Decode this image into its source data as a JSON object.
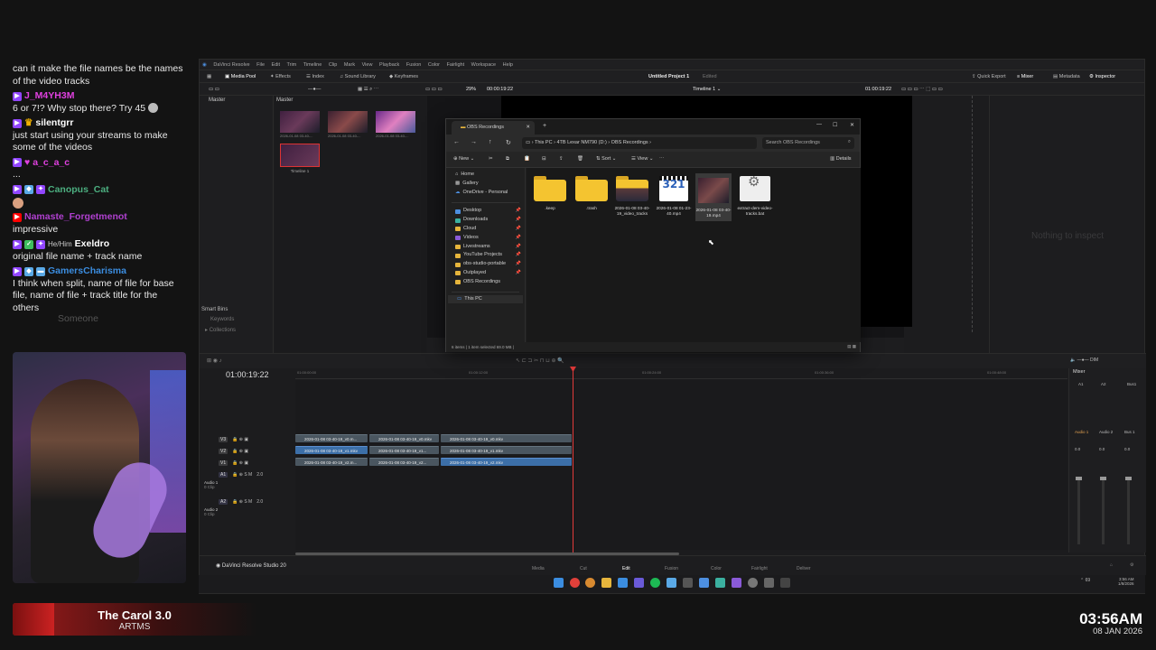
{
  "chat": {
    "messages": [
      {
        "text": "can it make the file names be the names of the video tracks"
      },
      {
        "user": "J_M4YH3M",
        "color": "#e040e0",
        "text": "6 or 7!? Why stop there? Try 45"
      },
      {
        "user": "silentgrr",
        "color": "#ffffff",
        "text": "just start using your streams to make some of the videos"
      },
      {
        "user": "a_c_a_c",
        "color": "#e040e0",
        "text": "..."
      },
      {
        "user": "Canopus_Cat",
        "color": "#4caf80",
        "text": ""
      },
      {
        "user": "Namaste_Forgetmenot",
        "color": "#b040d0",
        "text": "impressive"
      },
      {
        "user": "Exeldro",
        "pronoun": "He/Him",
        "color": "#ffffff",
        "text": "original file name + track name"
      },
      {
        "user": "GamersCharisma",
        "color": "#3b8de0",
        "text": "I think when split, name of file for base file, name of file + track title for the others"
      }
    ],
    "faded_user": "Someone"
  },
  "now_playing": {
    "title": "The Carol 3.0",
    "artist": "ARTMS"
  },
  "clock": {
    "time": "03:56AM",
    "date": "08 JAN 2026"
  },
  "resolve": {
    "menu": [
      "DaVinci Resolve",
      "File",
      "Edit",
      "Trim",
      "Timeline",
      "Clip",
      "Mark",
      "View",
      "Playback",
      "Fusion",
      "Color",
      "Fairlight",
      "Workspace",
      "Help"
    ],
    "toolbar_left": [
      "Media Pool",
      "Effects",
      "Index",
      "Sound Library",
      "Keyframes"
    ],
    "project_title": "Untitled Project 1",
    "project_status": "Edited",
    "toolbar_right": [
      "Quick Export",
      "Mixer",
      "Metadata",
      "Inspector"
    ],
    "zoom": "29%",
    "source_tc": "00:00:19:22",
    "timeline_name": "Timeline 1",
    "record_tc": "01:00:19:22",
    "bin_master": "Master",
    "pool_header": "Master",
    "pool_clips": [
      "2026-01-08 03-40-...",
      "2026-01-08 03-40-...",
      "2026-01-08 03-40-..."
    ],
    "pool_timeline": "Timeline 1",
    "smart_bins": "Smart Bins",
    "smart_items": [
      "Keywords",
      "Collections"
    ],
    "inspector_empty": "Nothing to inspect",
    "timeline_tc": "01:00:19:22",
    "ruler": [
      "01:00:00:00",
      "01:00:12:00",
      "01:00:24:00",
      "01:00:36:00",
      "01:00:48:00"
    ],
    "tracks": [
      {
        "id": "V3",
        "clips": [
          "2026-01-08 03-40-19_v0.m...",
          "2026-01-08 03-40-19_v0.mkv",
          "2026-01-08 03-40-19_v0.mkv"
        ]
      },
      {
        "id": "V2",
        "clips": [
          "2026-01-08 03-40-19_v1.mkv",
          "2026-01-08 03-40-19_v1...",
          "2026-01-08 03-40-19_v1.mkv"
        ]
      },
      {
        "id": "V1",
        "clips": [
          "2026-01-08 03-40-19_v2.m...",
          "2026-01-08 03-40-19_v2...",
          "2026-01-08 03-40-19_v2.mkv"
        ]
      }
    ],
    "audio_tracks": [
      {
        "id": "A1",
        "name": "Audio 1",
        "sub": "0 Clip",
        "level": "2.0"
      },
      {
        "id": "A2",
        "name": "Audio 2",
        "sub": "0 Clip",
        "level": "2.0"
      }
    ],
    "mixer": {
      "title": "Mixer",
      "channels": [
        "A1",
        "A2",
        "Bus1"
      ],
      "channels_lower": [
        "Audio 1",
        "Audio 2",
        "Bus 1"
      ],
      "dim": "DIM",
      "fader_values": [
        "0.0",
        "0.0",
        "0.0"
      ]
    },
    "pages": [
      "Media",
      "Cut",
      "Edit",
      "Fusion",
      "Color",
      "Fairlight",
      "Deliver"
    ],
    "active_page": "Edit",
    "brand": "DaVinci Resolve Studio 20"
  },
  "explorer": {
    "tab_title": "OBS Recordings",
    "breadcrumb": [
      "This PC",
      "4TB Lexar NM790 (D:)",
      "OBS Recordings"
    ],
    "search_placeholder": "Search OBS Recordings",
    "commands": [
      "New",
      "Sort",
      "View",
      "Details"
    ],
    "nav_top": [
      "Home",
      "Gallery",
      "OneDrive - Personal"
    ],
    "nav_pinned": [
      "Desktop",
      "Downloads",
      "Cloud",
      "Videos",
      "Livestreams",
      "YouTube Projects",
      "obs-studio-portable",
      "Outplayed",
      "OBS Recordings"
    ],
    "nav_bottom": [
      "This PC"
    ],
    "files": [
      {
        "name": ".keep",
        "type": "folder"
      },
      {
        "name": ".trash",
        "type": "folder"
      },
      {
        "name": "2026-01-08 03-40-19_video_tracks",
        "type": "folder-media"
      },
      {
        "name": "2026-01-08 01-23-40.mp4",
        "type": "video-321"
      },
      {
        "name": "2026-01-08 03-40-19.mp4",
        "type": "video-thumb"
      },
      {
        "name": "extract-dem-video-tracks.bat",
        "type": "bat"
      }
    ],
    "status": [
      "6 items",
      "1 item selected",
      "69.0 MB"
    ]
  },
  "taskbar": {
    "tray_temp": "69",
    "tray_time": "3:56 AM",
    "tray_date": "1/8/2026"
  }
}
